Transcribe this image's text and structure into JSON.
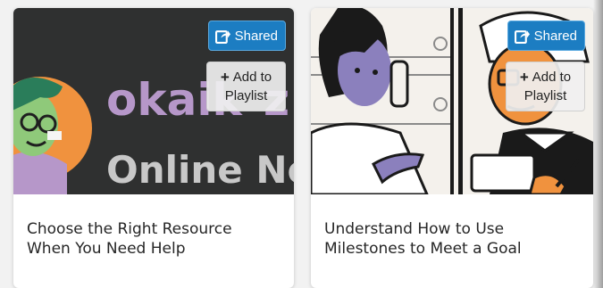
{
  "colors": {
    "shared_bg": "#1c7dc2",
    "dark_thumb_bg": "#2f3030",
    "logo_text": "#b697c9",
    "tagline_text": "#c8c8c8",
    "character_purple": "#8b80bd",
    "character_orange": "#f0923e"
  },
  "cards": [
    {
      "thumbnail": {
        "logo_text": "okaik",
        "logo_tail": "z",
        "tagline_text": "Online Now"
      },
      "title_line1": "Choose the Right Resource",
      "title_line2": "When You Need Help",
      "shared_label": "Shared",
      "shared_icon": "share-icon",
      "add_line1": "Add to",
      "add_line2": "Playlist"
    },
    {
      "title_line1": "Understand How to Use",
      "title_line2": "Milestones to Meet a Goal",
      "shared_label": "Shared",
      "shared_icon": "share-icon",
      "add_line1": "Add to",
      "add_line2": "Playlist"
    }
  ]
}
